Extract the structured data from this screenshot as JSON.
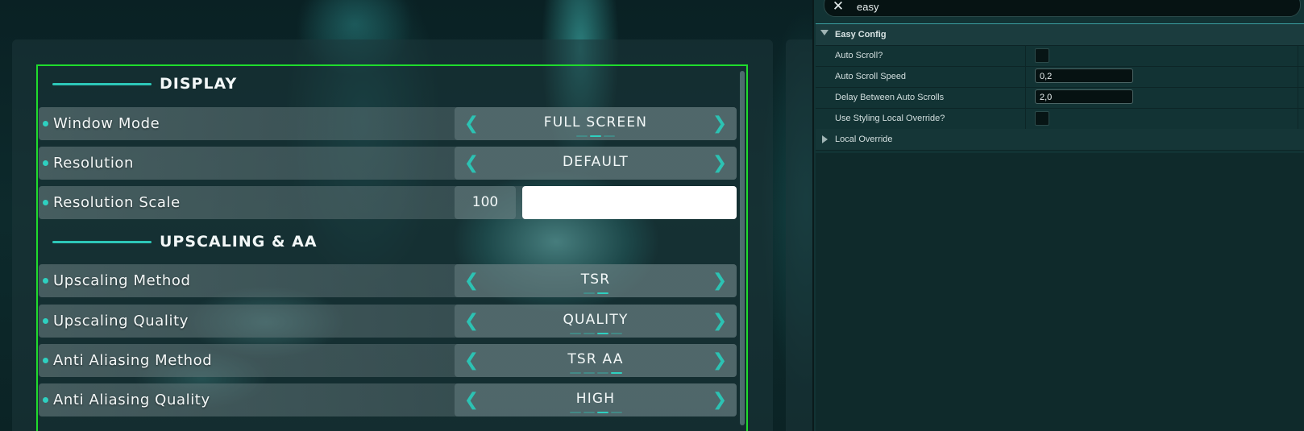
{
  "game_ui": {
    "sections": [
      {
        "title": "DISPLAY",
        "rows": [
          {
            "label": "Window Mode",
            "type": "selector",
            "value": "FULL SCREEN",
            "pips": 3,
            "active_pip": 1
          },
          {
            "label": "Resolution",
            "type": "selector",
            "value": "DEFAULT",
            "pips": 0,
            "active_pip": -1
          },
          {
            "label": "Resolution Scale",
            "type": "slider",
            "value": "100",
            "fill_percent": 100
          }
        ]
      },
      {
        "title": "UPSCALING & AA",
        "rows": [
          {
            "label": "Upscaling Method",
            "type": "selector",
            "value": "TSR",
            "pips": 2,
            "active_pip": 1
          },
          {
            "label": "Upscaling Quality",
            "type": "selector",
            "value": "QUALITY",
            "pips": 4,
            "active_pip": 2
          },
          {
            "label": "Anti Aliasing Method",
            "type": "selector",
            "value": "TSR AA",
            "pips": 4,
            "active_pip": 3
          },
          {
            "label": "Anti Aliasing Quality",
            "type": "selector",
            "value": "HIGH",
            "pips": 4,
            "active_pip": 2
          }
        ]
      }
    ],
    "arrow_left": "❮",
    "arrow_right": "❯",
    "colors": {
      "accent": "#2ed0c0",
      "frame": "#1fdc2c"
    }
  },
  "details_panel": {
    "search": {
      "value": "easy",
      "clear_glyph": "✕"
    },
    "category": {
      "label": "Easy Config"
    },
    "properties": [
      {
        "name": "Auto Scroll?",
        "type": "checkbox",
        "checked": false
      },
      {
        "name": "Auto Scroll Speed",
        "type": "number",
        "value": "0,2"
      },
      {
        "name": "Delay Between Auto Scrolls",
        "type": "number",
        "value": "2,0"
      },
      {
        "name": "Use Styling Local Override?",
        "type": "checkbox",
        "checked": false
      }
    ],
    "subcategory": {
      "label": "Local Override"
    }
  }
}
